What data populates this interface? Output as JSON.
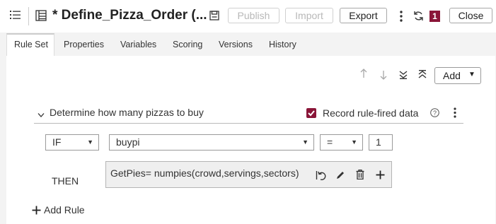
{
  "header": {
    "title": "* Define_Pizza_Order (...",
    "publish_label": "Publish",
    "import_label": "Import",
    "export_label": "Export",
    "close_label": "Close",
    "notification_count": "1"
  },
  "tabs": [
    {
      "label": "Rule Set"
    },
    {
      "label": "Properties"
    },
    {
      "label": "Variables"
    },
    {
      "label": "Scoring"
    },
    {
      "label": "Versions"
    },
    {
      "label": "History"
    }
  ],
  "toolbar": {
    "add_label": "Add"
  },
  "rule": {
    "name": "Determine how many pizzas to buy",
    "record_label": "Record rule-fired data",
    "record_checked": true,
    "condition": {
      "keyword": "IF",
      "variable": "buypi",
      "operator": "=",
      "value": "1"
    },
    "then_label": "THEN",
    "action": "GetPies= numpies(crowd,servings,sectors)"
  },
  "add_rule_label": "Add Rule",
  "colors": {
    "accent": "#8a1538",
    "border": "#9a9a9a"
  }
}
